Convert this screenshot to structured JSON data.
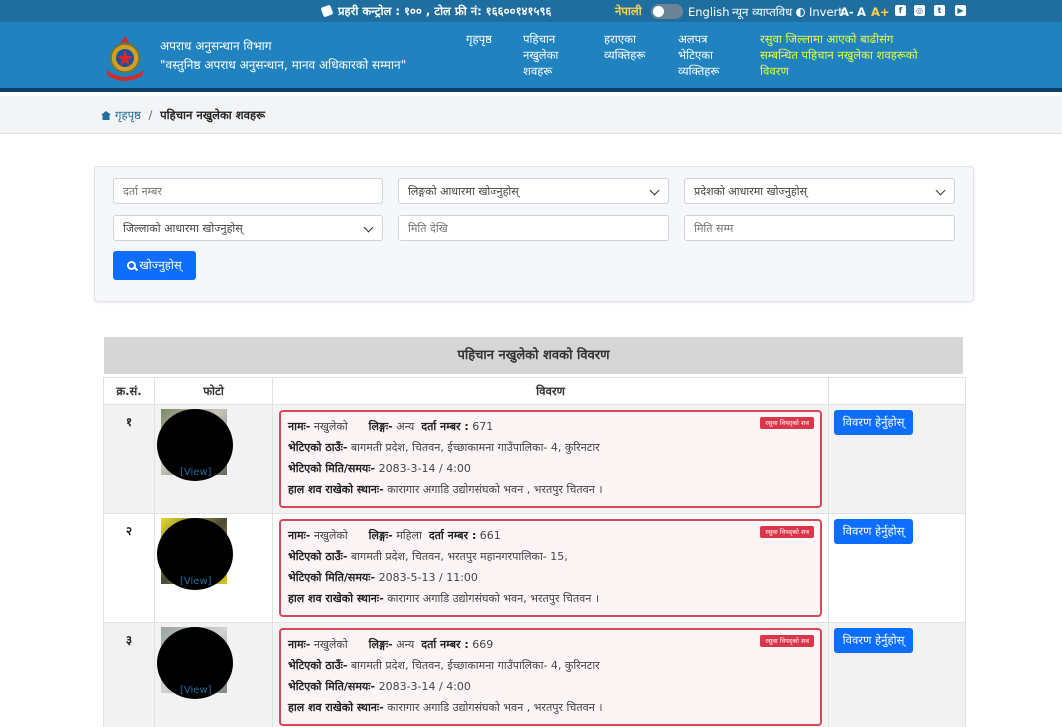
{
  "topbar": {
    "contact": "प्रहरी कन्ट्रोल : १०० , टोल फ्री नं: १६६००१४१५९६",
    "lang_np": "नेपाली",
    "lang_en": "English",
    "minimal": "न्यून व्याप्तविध",
    "invert": "Invert",
    "font_small": "A-",
    "font_normal": "A",
    "font_large": "A+",
    "social": [
      "facebook-icon",
      "instagram-icon",
      "twitter-icon",
      "youtube-icon"
    ]
  },
  "header": {
    "org_name": "अपराध अनुसन्धान विभाग",
    "tagline": "\"वस्तुनिष्ठ अपराध अनुसन्धान, मानव अधिकारको सम्मान\"",
    "nav": [
      {
        "line1": "गृहपृष्ठ",
        "line2": "",
        "line3": ""
      },
      {
        "line1": "पहिचान",
        "line2": "नखुलेका",
        "line3": "शवहरू"
      },
      {
        "line1": "हराएका",
        "line2": "व्यक्तिहरू",
        "line3": ""
      },
      {
        "line1": "अलपत्र",
        "line2": "भेटिएका",
        "line3": "व्यक्तिहरू"
      },
      {
        "line1": "रसुवा जिल्लामा आएको बाढीसंग",
        "line2": "सम्बन्धित पहिचान नखुलेका शवहरूको",
        "line3": "विवरण"
      }
    ],
    "colors": {
      "header_bg": "#2083c0",
      "topbar_bg": "#1f6ea0",
      "highlight": "#e6ff3b"
    }
  },
  "breadcrumb": {
    "home": "गृहपृष्ठ",
    "separator": "/",
    "current": "पहिचान नखुलेका शवहरू"
  },
  "search": {
    "reg_no_placeholder": "दर्ता नम्बर",
    "gender_select": "लिङ्गको आधारमा खोज्नुहोस्",
    "province_select": "प्रदेशको आधारमा खोज्नुहोस्",
    "district_select": "जिल्लाको आधारमा खोज्नुहोस्",
    "date_from_placeholder": "मिति देखि",
    "date_to_placeholder": "मिति सम्म",
    "button": "खोज्नुहोस्"
  },
  "table": {
    "title": "पहिचान नखुलेको शवको विवरण",
    "headers": {
      "sn": "क्र.सं.",
      "photo": "फोटो",
      "details": "विवरण"
    },
    "labels": {
      "name": "नामः-",
      "gender": "लिङ्गः-",
      "reg_no": "दर्ता नम्बर :",
      "found_place": "भेटिएको ठाउँः-",
      "found_datetime": "भेटिएको मिति/समयः-",
      "body_location": "हाल शव राखेको स्थानः-",
      "view_link": "[View]",
      "badge": "रसुवा विपद्को शव",
      "view_button": "विवरण हेर्नुहोस्"
    },
    "rows": [
      {
        "sn": "१",
        "name": "नखुलेको",
        "gender": "अन्य",
        "reg_no": "671",
        "found_place": "बागमती प्रदेश, चितवन, ईच्छाकामना गाउँपालिका- 4, कुरिनटार",
        "found_datetime": "2083-3-14 / 4:00",
        "body_location": "कारागार अगाडि उद्योगसंघको भवन , भरतपुर चितवन ।"
      },
      {
        "sn": "२",
        "name": "नखुलेको",
        "gender": "महिला",
        "reg_no": "661",
        "found_place": "बागमती प्रदेश, चितवन, भरतपुर महानगरपालिका- 15,",
        "found_datetime": "2083-5-13 / 11:00",
        "body_location": "कारागार अगाडि उद्योगसंघको भवन, भरतपुर चितवन ।"
      },
      {
        "sn": "३",
        "name": "नखुलेको",
        "gender": "अन्य",
        "reg_no": "669",
        "found_place": "बागमती प्रदेश, चितवन, ईच्छाकामना गाउँपालिका- 4, कुरिनटार",
        "found_datetime": "2083-3-14 / 4:00",
        "body_location": "कारागार अगाडि उद्योगसंघको भवन , भरतपुर चितवन ।"
      }
    ]
  }
}
